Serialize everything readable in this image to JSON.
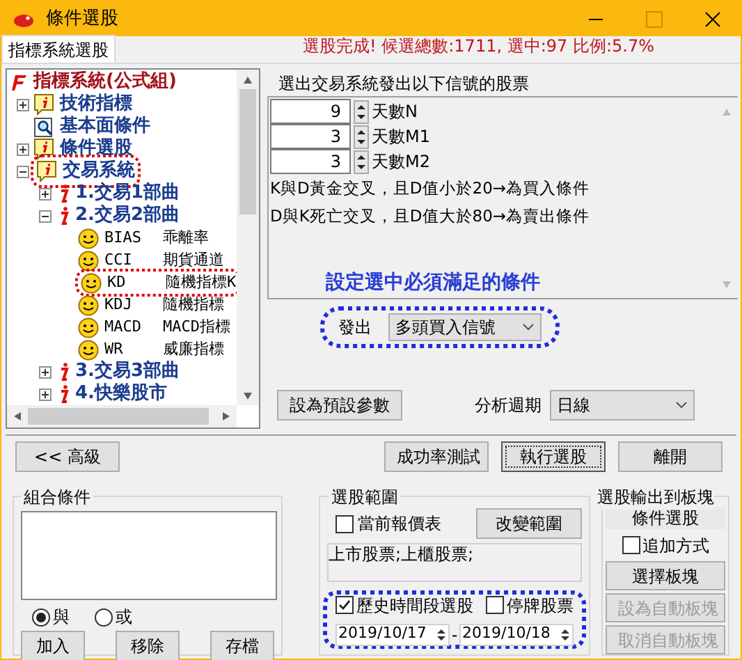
{
  "window": {
    "title": "條件選股"
  },
  "tabs": [
    {
      "label": "指標系統選股",
      "selected": true
    }
  ],
  "status": "選股完成! 候選總數:1711, 選中:97 比例:5.7%",
  "tree": {
    "label": "指標系統(公式組)",
    "children": [
      {
        "kind": "folder",
        "label": "技術指標",
        "expanded": false,
        "circled": false
      },
      {
        "kind": "search",
        "label": "基本面條件",
        "circled": false
      },
      {
        "kind": "folder",
        "label": "條件選股",
        "expanded": false,
        "circled": false
      },
      {
        "kind": "folder",
        "label": "交易系統",
        "expanded": true,
        "circled": true,
        "children": [
          {
            "kind": "part",
            "label": "1.交易1部曲",
            "expanded": false
          },
          {
            "kind": "part",
            "label": "2.交易2部曲",
            "expanded": true,
            "children": [
              {
                "kind": "indicator",
                "code": "BIAS",
                "name": "乖離率",
                "circled": false
              },
              {
                "kind": "indicator",
                "code": "CCI",
                "name": "期貨通道",
                "circled": false
              },
              {
                "kind": "indicator",
                "code": "KD",
                "name": "隨機指標K",
                "circled": true
              },
              {
                "kind": "indicator",
                "code": "KDJ",
                "name": "隨機指標",
                "circled": false
              },
              {
                "kind": "indicator",
                "code": "MACD",
                "name": "MACD指標",
                "circled": false
              },
              {
                "kind": "indicator",
                "code": "WR",
                "name": "威廉指標",
                "circled": false
              }
            ]
          },
          {
            "kind": "part",
            "label": "3.交易3部曲",
            "expanded": false
          },
          {
            "kind": "part",
            "label": "4.快樂股市",
            "expanded": false
          }
        ]
      }
    ]
  },
  "params_panel": {
    "heading": "選出交易系統發出以下信號的股票",
    "params": [
      {
        "value": "9",
        "label": "天數N"
      },
      {
        "value": "3",
        "label": "天數M1"
      },
      {
        "value": "3",
        "label": "天數M2"
      }
    ],
    "notes": [
      "K與D黃金交叉，且D值小於20→為買入條件",
      "D與K死亡交叉，且D值大於80→為賣出條件"
    ],
    "annotation": "設定選中必須滿足的條件",
    "signal": {
      "label": "發出",
      "value": "多頭買入信號",
      "circled": true
    },
    "default_button": "設為預設參數",
    "period": {
      "label": "分析週期",
      "value": "日線"
    }
  },
  "action_buttons": [
    {
      "label": "<< 高級",
      "focused": false
    },
    {
      "label": "成功率測試",
      "focused": false
    },
    {
      "label": "執行選股",
      "focused": true
    },
    {
      "label": "離開",
      "focused": false
    }
  ],
  "combo": {
    "title": "組合條件",
    "radios": [
      {
        "label": "與",
        "selected": true
      },
      {
        "label": "或",
        "selected": false
      }
    ],
    "buttons": [
      "加入",
      "移除",
      "存檔"
    ]
  },
  "range": {
    "title": "選股範圍",
    "quote_checkbox": {
      "label": "當前報價表",
      "checked": false
    },
    "change_button": "改變範圍",
    "scope": "上市股票;上櫃股票;",
    "history": {
      "circled": true,
      "checkbox": {
        "label": "歷史時間段選股",
        "checked": true
      },
      "suspended": {
        "label": "停牌股票",
        "checked": false
      },
      "from": "2019/10/17",
      "separator": "-",
      "to": "2019/10/18"
    }
  },
  "output": {
    "title": "選股輸出到板塊",
    "block": "條件選股",
    "append": {
      "label": "追加方式",
      "checked": false
    },
    "buttons": [
      {
        "label": "選擇板塊",
        "disabled": false
      },
      {
        "label": "設為自動板塊",
        "disabled": true
      },
      {
        "label": "取消自動板塊",
        "disabled": true
      }
    ]
  }
}
